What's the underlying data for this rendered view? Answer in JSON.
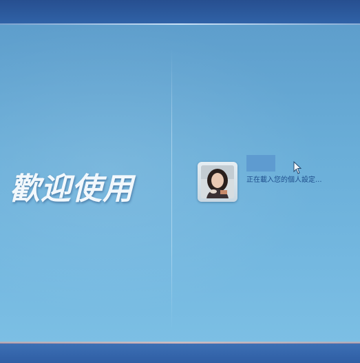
{
  "welcome": {
    "text": "歡迎使用"
  },
  "user": {
    "avatar_icon": "user-photo-icon",
    "username": "",
    "status": "正在載入您的個人設定..."
  },
  "cursor": {
    "icon": "mouse-pointer-icon"
  },
  "colors": {
    "panel": "#6aaed8",
    "bands": "#2f5ea4",
    "welcome_text": "#f2f8fc",
    "status_text": "#1e4e8c"
  }
}
